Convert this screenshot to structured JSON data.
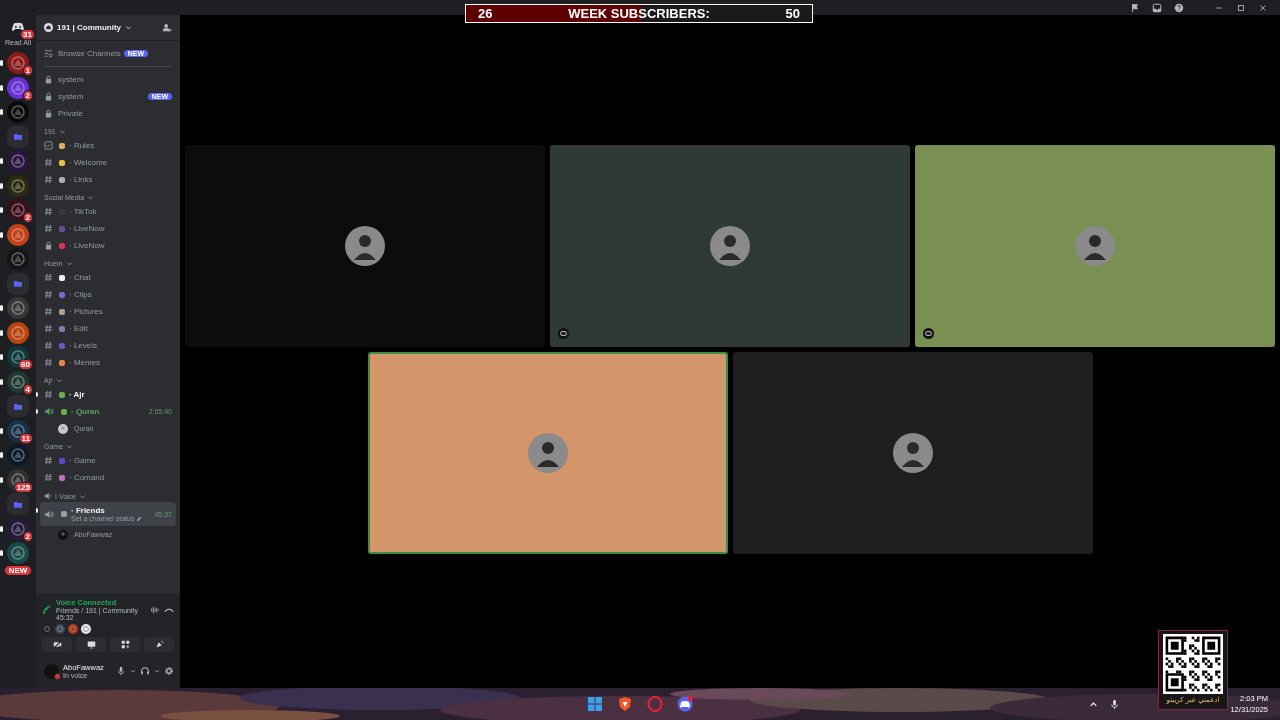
{
  "title_bar": {
    "goal": {
      "start": "26",
      "label": "WEEK SUBSCRIBERS:",
      "target": "50",
      "level": 0.51
    }
  },
  "server_rail": {
    "home_badge": "31",
    "read_all": "Read All",
    "servers": [
      {
        "kind": "server",
        "color": "#8b1a1a",
        "badge": "1",
        "unread": true
      },
      {
        "kind": "server",
        "color": "#6a2fd4",
        "badge": "2",
        "unread": true
      },
      {
        "kind": "server",
        "color": "#0a0a0a",
        "unread": true
      },
      {
        "kind": "folder"
      },
      {
        "kind": "server",
        "color": "#2a1540",
        "unread": true
      },
      {
        "kind": "server",
        "color": "#2e2c10",
        "unread": true
      },
      {
        "kind": "server",
        "color": "#3a0f18",
        "badge": "2",
        "unread": true
      },
      {
        "kind": "server",
        "color": "#c0401a",
        "unread": true
      },
      {
        "kind": "server",
        "color": "#151515",
        "unread": false
      },
      {
        "kind": "folder"
      },
      {
        "kind": "server",
        "color": "#383838",
        "unread": true
      },
      {
        "kind": "server",
        "color": "#b84410",
        "unread": true
      },
      {
        "kind": "server",
        "color": "#0e3a3a",
        "badge": "60",
        "unread": true
      },
      {
        "kind": "server",
        "color": "#1f3a30",
        "badge": "4",
        "unread": true
      },
      {
        "kind": "folder"
      },
      {
        "kind": "server",
        "color": "#17324a",
        "badge": "11",
        "unread": true
      },
      {
        "kind": "server",
        "color": "#0b1a2a",
        "unread": true
      },
      {
        "kind": "server",
        "color": "#303030",
        "badge": "125",
        "unread": true
      },
      {
        "kind": "folder"
      },
      {
        "kind": "server",
        "color": "#241a3a",
        "badge": "2",
        "unread": true
      },
      {
        "kind": "server",
        "color": "#1a4a4a",
        "badge": "NEW",
        "unread": true
      }
    ]
  },
  "sidebar": {
    "server_name": "191 | Community",
    "browse": {
      "label": "Browse Channels",
      "badge": "NEW"
    },
    "sections": [
      {
        "kind": "plain",
        "channels": [
          {
            "kind": "locked",
            "name": "system",
            "selected": false,
            "unread": false
          },
          {
            "kind": "locked",
            "name": "system",
            "badge": "NEW",
            "selected": false,
            "unread": false
          },
          {
            "kind": "locked",
            "name": "Private",
            "selected": false,
            "unread": false
          }
        ]
      },
      {
        "kind": "text",
        "category": "191",
        "channels": [
          {
            "kind": "rules",
            "name": "· Rules",
            "color": "#e0b060",
            "selected": false,
            "unread": false
          },
          {
            "kind": "text",
            "name": "· Welcome",
            "color": "#f0c040",
            "selected": false,
            "unread": false
          },
          {
            "kind": "text",
            "name": "· Links",
            "color": "#b0b0b0",
            "selected": false,
            "unread": false
          }
        ]
      },
      {
        "kind": "text",
        "category": "Social Media",
        "channels": [
          {
            "kind": "text",
            "name": "· TikTok",
            "color": "#3a3a3a",
            "selected": false,
            "unread": false
          },
          {
            "kind": "text",
            "name": "· LiveNow",
            "color": "#6a4a9a",
            "selected": false,
            "unread": false
          },
          {
            "kind": "locked",
            "name": "· LiveNow",
            "color": "#e0305a",
            "selected": false,
            "unread": false
          }
        ]
      },
      {
        "kind": "text",
        "category": "Hoem",
        "channels": [
          {
            "kind": "text",
            "name": "· Chat",
            "color": "#f0f0f0",
            "selected": false,
            "unread": false
          },
          {
            "kind": "text",
            "name": "· Clips",
            "color": "#7a6ad0",
            "selected": false,
            "unread": false
          },
          {
            "kind": "text",
            "name": "· Pictures",
            "color": "#b0a090",
            "selected": false,
            "unread": false
          },
          {
            "kind": "text",
            "name": "· Edit",
            "color": "#8a7ab0",
            "selected": false,
            "unread": false
          },
          {
            "kind": "text",
            "name": "· Levels",
            "color": "#6a5ac0",
            "selected": false,
            "unread": false
          },
          {
            "kind": "text",
            "name": "· Memes",
            "color": "#f08050",
            "selected": false,
            "unread": false
          }
        ]
      },
      {
        "kind": "text",
        "category": "Ajr",
        "channels": [
          {
            "kind": "text",
            "name": "· Ajr",
            "color": "#6ab04a",
            "selected": false,
            "unread": true
          },
          {
            "kind": "voice",
            "name": "· Quran",
            "color": "#6ab04a",
            "selected": false,
            "unread": true,
            "live": true,
            "time": "2:55:40",
            "members": [
              {
                "name": "Quran",
                "color": "#c8c8c8"
              }
            ]
          }
        ]
      },
      {
        "kind": "text",
        "category": "Game",
        "channels": [
          {
            "kind": "text",
            "name": "· Game",
            "color": "#5a4ad0",
            "selected": false,
            "unread": false
          },
          {
            "kind": "text",
            "name": "· Comand",
            "color": "#c070c0",
            "selected": false,
            "unread": false
          }
        ]
      },
      {
        "kind": "voice",
        "category": "I Voice",
        "channels": [
          {
            "kind": "voice",
            "name": "· Friends",
            "color": "#a0a0a0",
            "selected": true,
            "unread": true,
            "live": false,
            "time": "45:37",
            "status": "Set a channel status",
            "members": [
              {
                "name": "AboFawwaz",
                "color": "#111111"
              }
            ]
          }
        ]
      }
    ]
  },
  "voice_panel": {
    "state": "Voice Connected",
    "channel": "Friends / 191 | Community",
    "elapsed": "45:32",
    "participants": [
      {
        "color": "#222222"
      },
      {
        "color": "#3a4a5a"
      },
      {
        "color": "#b83a1a"
      },
      {
        "color": "#e8e8e8"
      }
    ]
  },
  "user_panel": {
    "name": "AboFawwaz",
    "status": "In voice"
  },
  "tiles": [
    {
      "color": "#0c0c0c",
      "speaking": false,
      "streaming": false
    },
    {
      "color": "#2e3a33",
      "speaking": false,
      "streaming": true
    },
    {
      "color": "#7a8f52",
      "speaking": false,
      "streaming": true
    },
    {
      "color": "#d4956a",
      "speaking": true,
      "streaming": false
    },
    {
      "color": "#1e1e1e",
      "speaking": false,
      "streaming": false
    }
  ],
  "qr": {
    "caption": "ادعمني عبر كريبتو"
  },
  "clock": {
    "time": "2:03 PM",
    "date": "12/31/2025"
  }
}
